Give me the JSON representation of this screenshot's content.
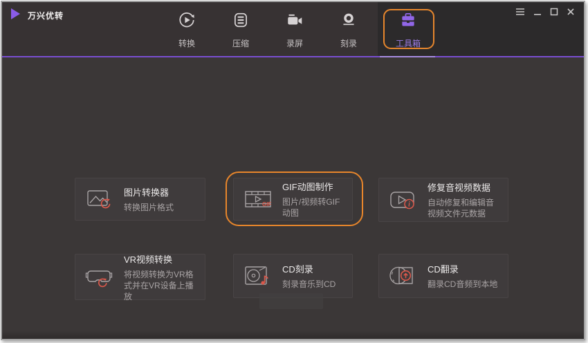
{
  "window": {
    "title": "万兴优转",
    "controls": [
      "menu-icon",
      "minimize-icon",
      "maximize-icon",
      "close-icon"
    ]
  },
  "tabs": [
    {
      "label": "转换",
      "icon": "convert-icon",
      "active": false
    },
    {
      "label": "压缩",
      "icon": "compress-icon",
      "active": false
    },
    {
      "label": "录屏",
      "icon": "screen-record-icon",
      "active": false
    },
    {
      "label": "刻录",
      "icon": "burn-icon",
      "active": false
    },
    {
      "label": "工具箱",
      "icon": "toolbox-icon",
      "active": true
    }
  ],
  "toolbox": {
    "cards": [
      {
        "title": "图片转换器",
        "subtitle": "转换图片格式",
        "icon": "image-converter-icon",
        "highlighted": false
      },
      {
        "title": "GIF动图制作",
        "subtitle": "图片/视频转GIF动图",
        "icon": "gif-maker-icon",
        "highlighted": true
      },
      {
        "title": "修复音视频数据",
        "subtitle": "自动修复和编辑音视频文件元数据",
        "icon": "fix-media-metadata-icon",
        "highlighted": false
      },
      {
        "title": "VR视频转换",
        "subtitle": "将视频转换为VR格式并在VR设备上播放",
        "icon": "vr-converter-icon",
        "highlighted": false
      },
      {
        "title": "CD刻录",
        "subtitle": "刻录音乐到CD",
        "icon": "cd-burner-icon",
        "highlighted": false
      },
      {
        "title": "CD翻录",
        "subtitle": "翻录CD音频到本地",
        "icon": "cd-ripper-icon",
        "highlighted": false
      }
    ]
  },
  "colors": {
    "highlight_orange": "#E8862B",
    "accent_purple": "#7A4ED2",
    "active_tab_purple": "#9166E8",
    "badge_red": "#D9584B",
    "header_bg": "#373233",
    "content_bg": "#3B3737",
    "card_bg": "#3F3B3C"
  }
}
